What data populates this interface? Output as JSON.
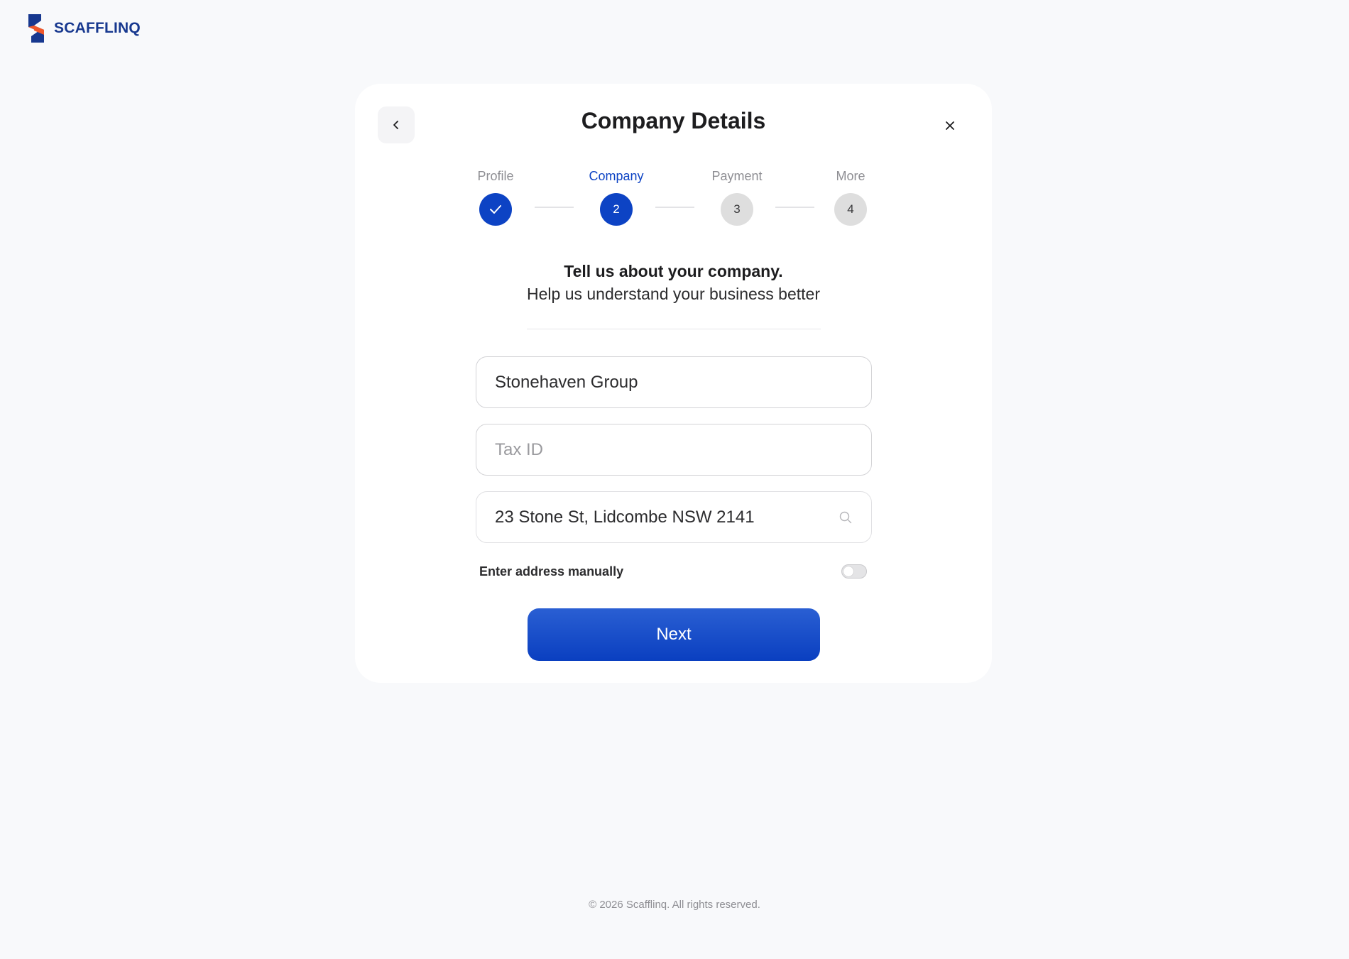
{
  "brand": {
    "name": "SCAFFLINQ",
    "colors": {
      "primary": "#17388f",
      "accent": "#f0572a"
    }
  },
  "modal": {
    "title": "Company Details",
    "back_icon": "chevron-left-icon",
    "close_icon": "close-icon"
  },
  "stepper": {
    "steps": [
      {
        "label": "Profile",
        "marker": "",
        "state": "done"
      },
      {
        "label": "Company",
        "marker": "2",
        "state": "active"
      },
      {
        "label": "Payment",
        "marker": "3",
        "state": "pending"
      },
      {
        "label": "More",
        "marker": "4",
        "state": "pending"
      }
    ],
    "active_color": "#0d43c4"
  },
  "intro": {
    "heading": "Tell us about your company.",
    "subheading": "Help us understand your business better"
  },
  "form": {
    "company_name": {
      "value": "Stonehaven Group",
      "placeholder": ""
    },
    "tax_id": {
      "value": "",
      "placeholder": "Tax ID"
    },
    "address": {
      "value": "23 Stone St, Lidcombe NSW 2141",
      "placeholder": "",
      "icon": "search-icon"
    },
    "manual_address": {
      "label": "Enter address manually",
      "enabled": false
    }
  },
  "actions": {
    "next_label": "Next"
  },
  "footer": {
    "copyright": "© 2026 Scafflinq. All rights reserved."
  }
}
